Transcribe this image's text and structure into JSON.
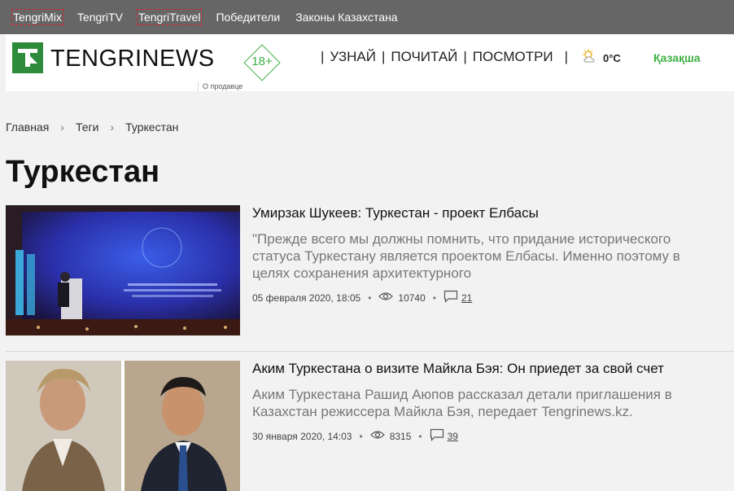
{
  "topbar": {
    "links": [
      "TengriMix",
      "TengriTV",
      "TengriTravel",
      "Победители",
      "Законы Казахстана"
    ]
  },
  "header": {
    "logo_text": "TENGRINEWS",
    "age_rating": "18+",
    "nav": [
      "УЗНАЙ",
      "ПОЧИТАЙ",
      "ПОСМОТРИ"
    ],
    "weather": "0°C",
    "language": "Қазақша",
    "seller_note": "О продавце"
  },
  "breadcrumb": [
    "Главная",
    "Теги",
    "Туркестан"
  ],
  "page_title": "Туркестан",
  "articles": [
    {
      "title": "Умирзак Шукеев: Туркестан - проект Елбасы",
      "lead": "\"Прежде всего мы должны помнить, что придание исторического статуса Туркестану является проектом Елбасы. Именно поэтому в целях сохранения архитектурного",
      "date": "05 февраля 2020, 18:05",
      "views": "10740",
      "comments": "21"
    },
    {
      "title": "Аким Туркестана о визите Майкла Бэя: Он приедет за свой счет",
      "lead": "Аким Туркестана Рашид Аюпов рассказал детали приглашения в Казахстан режиссера Майкла Бэя, передает Tengrinews.kz.",
      "date": "30 января 2020, 14:03",
      "views": "8315",
      "comments": "39"
    }
  ],
  "colors": {
    "brand_green": "#2e8b3c",
    "accent_green": "#3cb043",
    "topbar_bg": "#666666"
  }
}
